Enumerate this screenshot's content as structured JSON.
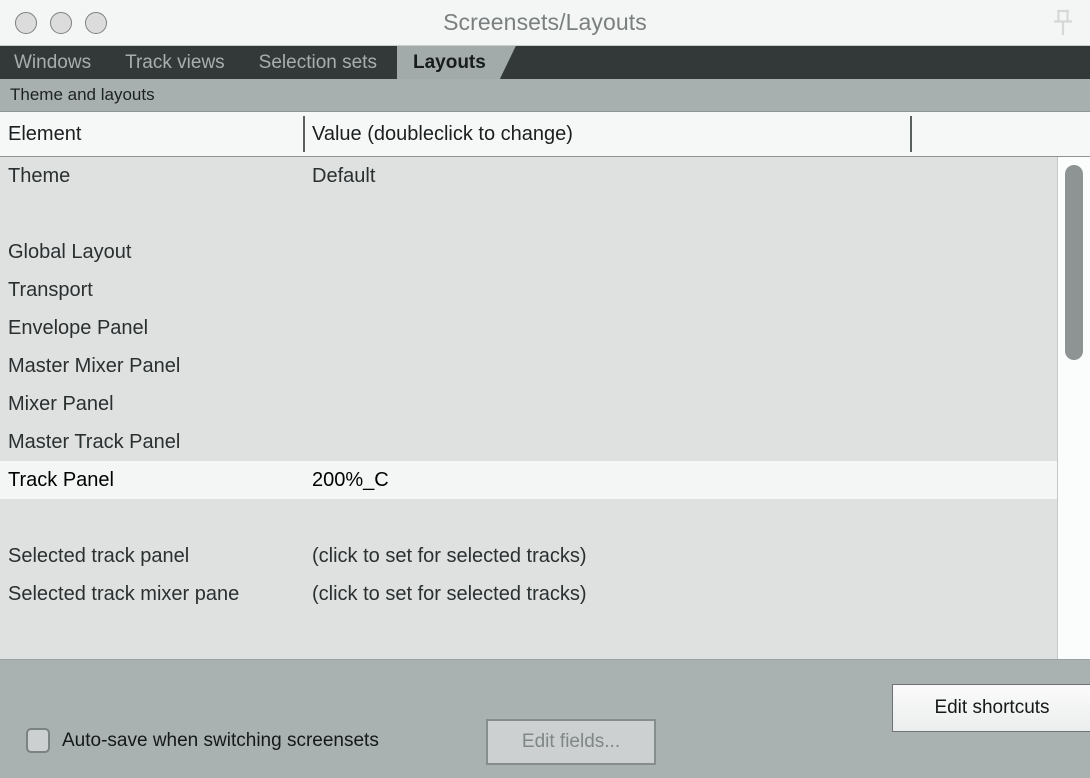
{
  "window": {
    "title": "Screensets/Layouts",
    "traffic_lights": [
      "close-button",
      "minimize-button",
      "zoom-button"
    ],
    "pin_icon": "pushpin-icon"
  },
  "tabs": [
    {
      "label": "Windows",
      "active": false
    },
    {
      "label": "Track views",
      "active": false
    },
    {
      "label": "Selection sets",
      "active": false
    },
    {
      "label": "Layouts",
      "active": true
    }
  ],
  "subheader": {
    "label": "Theme and layouts"
  },
  "table": {
    "columns": [
      {
        "label": "Element"
      },
      {
        "label": "Value (doubleclick to change)"
      },
      {
        "label": ""
      }
    ],
    "rows": [
      {
        "element": "Theme",
        "value": "Default",
        "selected": false,
        "spacer": false
      },
      {
        "element": "",
        "value": "",
        "selected": false,
        "spacer": true
      },
      {
        "element": "Global Layout",
        "value": "",
        "selected": false,
        "spacer": false
      },
      {
        "element": "Transport",
        "value": "",
        "selected": false,
        "spacer": false
      },
      {
        "element": "Envelope Panel",
        "value": "",
        "selected": false,
        "spacer": false
      },
      {
        "element": "Master Mixer Panel",
        "value": "",
        "selected": false,
        "spacer": false
      },
      {
        "element": "Mixer Panel",
        "value": "",
        "selected": false,
        "spacer": false
      },
      {
        "element": "Master Track Panel",
        "value": "",
        "selected": false,
        "spacer": false
      },
      {
        "element": "Track Panel",
        "value": "200%_C",
        "selected": true,
        "spacer": false
      },
      {
        "element": "",
        "value": "",
        "selected": false,
        "spacer": true
      },
      {
        "element": "Selected track panel",
        "value": "(click to set for selected tracks)",
        "selected": false,
        "spacer": false
      },
      {
        "element": "Selected track mixer pane",
        "value": "(click to set for selected tracks)",
        "selected": false,
        "spacer": false
      }
    ]
  },
  "scrollbar": {
    "orientation": "vertical",
    "thumb_position": "top"
  },
  "footer": {
    "edit_shortcuts_label": "Edit shortcuts",
    "edit_fields_label": "Edit fields...",
    "edit_fields_disabled": true,
    "autosave_label": "Auto-save when switching screensets",
    "autosave_checked": false
  },
  "colors": {
    "window_chrome": "#b0b6b6",
    "titlebar": "#f4f5f5",
    "tabstrip": "#333838",
    "tab_active": "#a2aaaa",
    "subheader": "#a8afaf",
    "list_bg": "#dfe1e1",
    "row_selected": "#f4f5f5",
    "footer": "#aab1b1",
    "scrollbar_thumb": "#8e9393"
  }
}
